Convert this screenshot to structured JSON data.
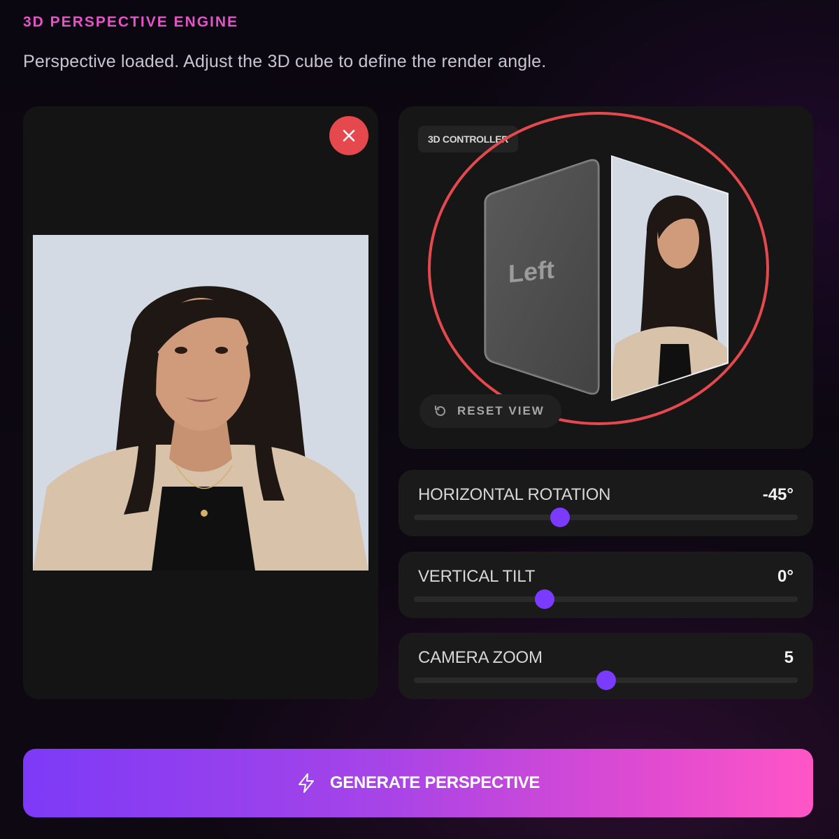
{
  "header": {
    "eyebrow": "3D PERSPECTIVE ENGINE",
    "subtitle": "Perspective loaded. Adjust the 3D cube to define the render angle."
  },
  "image_card": {
    "remove_icon": "close-icon"
  },
  "controller": {
    "badge": "3D CONTROLLER",
    "left_face_label": "Left",
    "reset_label": "RESET VIEW",
    "reset_icon": "rotate-ccw-icon",
    "highlight_color": "#e5484d"
  },
  "sliders": [
    {
      "label": "HORIZONTAL ROTATION",
      "value": "-45°",
      "fraction": 0.38
    },
    {
      "label": "VERTICAL TILT",
      "value": "0°",
      "fraction": 0.34
    },
    {
      "label": "CAMERA ZOOM",
      "value": "5",
      "fraction": 0.5
    }
  ],
  "generate": {
    "label": "GENERATE PERSPECTIVE",
    "icon": "lightning-icon"
  },
  "colors": {
    "accent": "#7a3bff",
    "eyebrow": "#e553c7",
    "danger": "#e5484d",
    "gradient_start": "#7d3af6",
    "gradient_end": "#ff56c6"
  }
}
